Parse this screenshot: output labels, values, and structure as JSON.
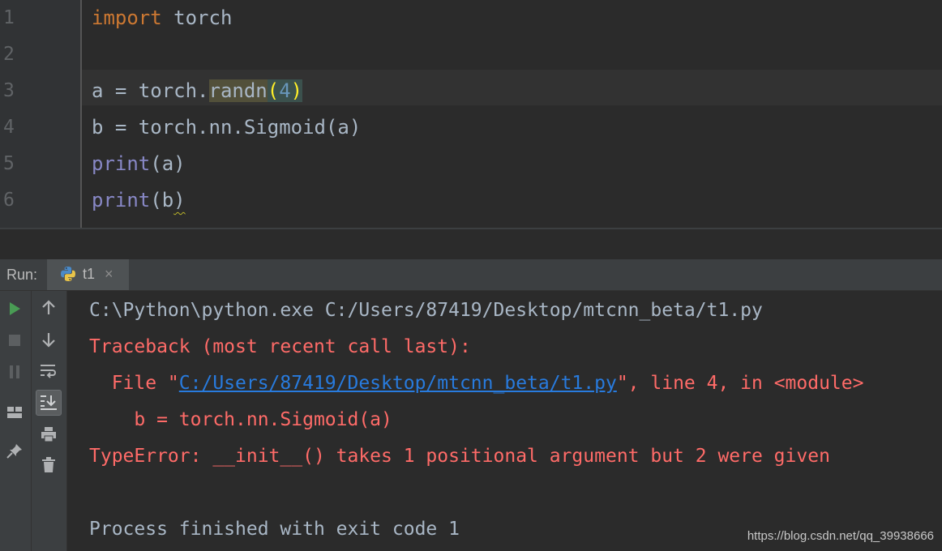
{
  "editor": {
    "line_numbers": [
      "1",
      "2",
      "3",
      "4",
      "5",
      "6"
    ],
    "line1": {
      "kw": "import",
      "rest": " torch"
    },
    "line3": {
      "prefix": "a = torch.",
      "call": "randn",
      "open": "(",
      "arg": "4",
      "close": ")"
    },
    "line4": {
      "text": "b = torch.nn.Sigmoid(a)"
    },
    "line5": {
      "fn": "print",
      "args": "(a)"
    },
    "line6": {
      "fn": "print",
      "args_open": "(b",
      "args_close": ")"
    }
  },
  "run_panel": {
    "label": "Run:",
    "tab": {
      "label": "t1",
      "close": "×",
      "icon": "python-icon"
    }
  },
  "toolbar_left": [
    "run-icon",
    "stop-icon",
    "pause-icon",
    "layout-icon",
    "pin-icon"
  ],
  "toolbar_right": [
    "up-arrow-icon",
    "down-arrow-icon",
    "soft-wrap-icon",
    "scroll-to-end-icon",
    "print-icon",
    "trash-icon"
  ],
  "console": {
    "cmd": "C:\\Python\\python.exe C:/Users/87419/Desktop/mtcnn_beta/t1.py",
    "traceback": "Traceback (most recent call last):",
    "file_prefix": "  File \"",
    "file_link": "C:/Users/87419/Desktop/mtcnn_beta/t1.py",
    "file_suffix": "\", line 4, in <module>",
    "code": "    b = torch.nn.Sigmoid(a)",
    "error": "TypeError: __init__() takes 1 positional argument but 2 were given",
    "exit": "Process finished with exit code 1"
  },
  "watermark": "https://blog.csdn.net/qq_39938666",
  "colors": {
    "background": "#2b2b2b",
    "keyword": "#cc7832",
    "builtin": "#8888c6",
    "number": "#6897bb",
    "error": "#ff6b68",
    "link": "#287bde",
    "run_green": "#499c54"
  }
}
